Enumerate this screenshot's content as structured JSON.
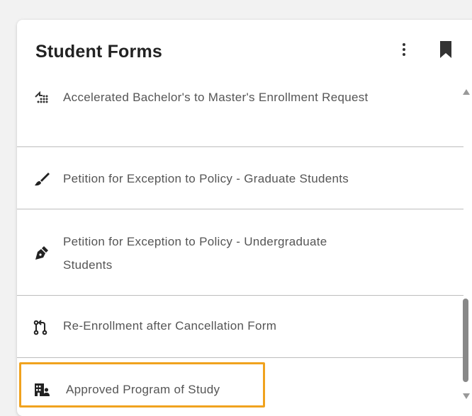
{
  "card": {
    "title": "Student Forms",
    "menu_icon": "more-vertical-icon",
    "bookmark_icon": "bookmark-icon"
  },
  "forms": [
    {
      "label": "Accelerated Bachelor's to Master's Enrollment Request",
      "icon": "stairs-dots-icon"
    },
    {
      "label": "Petition for Exception to Policy - Graduate Students",
      "icon": "paintbrush-icon"
    },
    {
      "label": "Petition for Exception to Policy - Undergraduate",
      "label_line2": "Students",
      "icon": "pen-nib-icon"
    },
    {
      "label": "Re-Enrollment after Cancellation Form",
      "icon": "pull-request-icon"
    },
    {
      "label": "Approved Program of Study",
      "icon": "building-user-icon"
    }
  ],
  "colors": {
    "highlight": "#f0a21e",
    "text": "#555555",
    "title": "#222222"
  }
}
